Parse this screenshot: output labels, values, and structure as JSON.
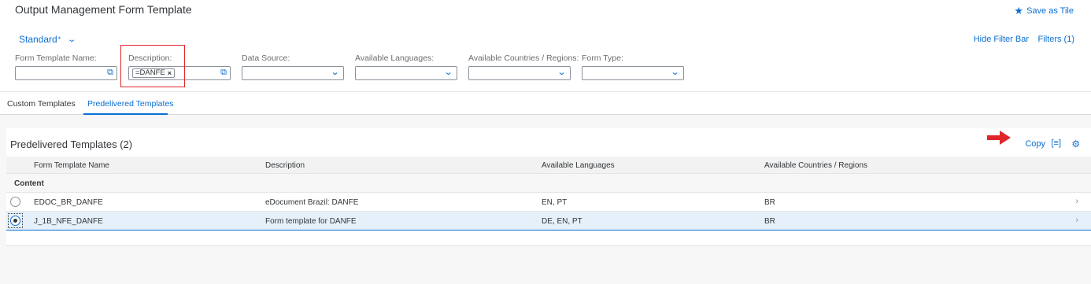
{
  "header": {
    "title": "Output Management Form Template",
    "save_as_tile": "Save as Tile"
  },
  "filterbar": {
    "variant_name": "Standard",
    "variant_modified": "*",
    "hide_filter_bar": "Hide Filter Bar",
    "filters": "Filters (1)",
    "fields": {
      "form_template_name": {
        "label": "Form Template Name:",
        "value": ""
      },
      "description": {
        "label": "Description:",
        "token": "=DANFE"
      },
      "data_source": {
        "label": "Data Source:",
        "value": ""
      },
      "available_languages": {
        "label": "Available Languages:",
        "value": ""
      },
      "available_countries": {
        "label": "Available Countries / Regions:",
        "value": ""
      },
      "form_type": {
        "label": "Form Type:",
        "value": ""
      }
    }
  },
  "tabs": {
    "custom": "Custom Templates",
    "predelivered": "Predelivered Templates",
    "active": "predelivered"
  },
  "table": {
    "title": "Predelivered Templates (2)",
    "copy_label": "Copy",
    "columns": [
      "Form Template Name",
      "Description",
      "Available Languages",
      "Available Countries / Regions"
    ],
    "group_label": "Content",
    "rows": [
      {
        "name": "EDOC_BR_DANFE",
        "description": "eDocument Brazil: DANFE",
        "languages": "EN, PT",
        "countries": "BR",
        "selected": false
      },
      {
        "name": "J_1B_NFE_DANFE",
        "description": "Form template for DANFE",
        "languages": "DE, EN, PT",
        "countries": "BR",
        "selected": true
      }
    ]
  },
  "icons": {
    "save_tile": "star-icon",
    "variant_dropdown": "chevron-down-icon",
    "value_help": "value-help-icon",
    "dropdown": "chevron-down-icon",
    "token_remove": "close-icon",
    "view_settings": "list-settings-icon",
    "settings": "gear-icon",
    "row_navigation": "chevron-right-icon",
    "annotation_arrow": "red-arrow-icon"
  },
  "colors": {
    "accent": "#0a6ed1",
    "highlight": "#e0262b",
    "selected_row": "#e5f0fa"
  }
}
